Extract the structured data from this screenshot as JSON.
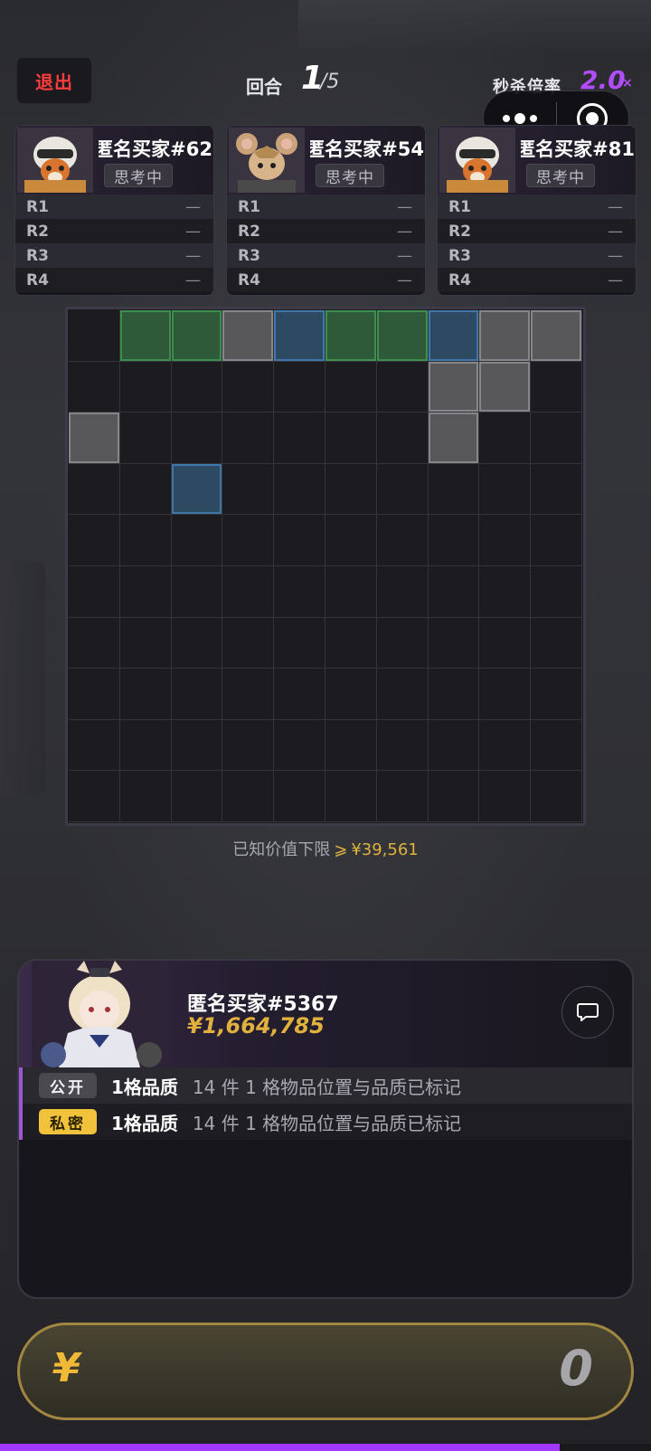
{
  "header": {
    "exit_label": "退出",
    "round_label": "回合",
    "round_current": "1",
    "round_total": "/5",
    "multiplier_label": "秒杀倍率",
    "multiplier_value": "2.0",
    "multiplier_suffix": "×"
  },
  "miniprogram_capsule": {
    "more_icon": "more-dots-icon",
    "close_icon": "target-close-icon"
  },
  "players": [
    {
      "name": "匿名买家#62",
      "status": "思考中",
      "avatar_icon": "fox-pilot-avatar",
      "rounds": [
        {
          "label": "R1",
          "value": "—"
        },
        {
          "label": "R2",
          "value": "—"
        },
        {
          "label": "R3",
          "value": "—"
        },
        {
          "label": "R4",
          "value": "—"
        }
      ]
    },
    {
      "name": "匿名买家#54",
      "status": "思考中",
      "avatar_icon": "mouse-soldier-avatar",
      "rounds": [
        {
          "label": "R1",
          "value": "—"
        },
        {
          "label": "R2",
          "value": "—"
        },
        {
          "label": "R3",
          "value": "—"
        },
        {
          "label": "R4",
          "value": "—"
        }
      ]
    },
    {
      "name": "匿名买家#81",
      "status": "思考中",
      "avatar_icon": "fox-pilot-avatar",
      "rounds": [
        {
          "label": "R1",
          "value": "—"
        },
        {
          "label": "R2",
          "value": "—"
        },
        {
          "label": "R3",
          "value": "—"
        },
        {
          "label": "R4",
          "value": "—"
        }
      ]
    }
  ],
  "grid": {
    "rows": 10,
    "cols": 10,
    "colors": {
      "green": "#3c8f4d",
      "blue": "#3f78a8",
      "gray": "#86858a"
    },
    "marked": [
      [
        "",
        "green",
        "green",
        "gray",
        "blue",
        "green",
        "green",
        "blue",
        "gray",
        "gray"
      ],
      [
        "",
        "",
        "",
        "",
        "",
        "",
        "",
        "gray",
        "gray",
        ""
      ],
      [
        "gray",
        "",
        "",
        "",
        "",
        "",
        "",
        "gray",
        "",
        ""
      ],
      [
        "",
        "",
        "blue",
        "",
        "",
        "",
        "",
        "",
        "",
        ""
      ],
      [
        "",
        "",
        "",
        "",
        "",
        "",
        "",
        "",
        "",
        ""
      ],
      [
        "",
        "",
        "",
        "",
        "",
        "",
        "",
        "",
        "",
        ""
      ],
      [
        "",
        "",
        "",
        "",
        "",
        "",
        "",
        "",
        "",
        ""
      ],
      [
        "",
        "",
        "",
        "",
        "",
        "",
        "",
        "",
        "",
        ""
      ],
      [
        "",
        "",
        "",
        "",
        "",
        "",
        "",
        "",
        "",
        ""
      ],
      [
        "",
        "",
        "",
        "",
        "",
        "",
        "",
        "",
        "",
        ""
      ]
    ]
  },
  "value_info": {
    "label": "已知价值下限",
    "symbol": "⩾",
    "amount": "¥39,561"
  },
  "me": {
    "name": "匿名买家#5367",
    "money": "¥1,664,785",
    "avatar_icon": "bunny-girl-avatar",
    "chat_icon": "chat-bubble-icon",
    "clues": [
      {
        "tag": "公开",
        "title": "1格品质",
        "desc": "14 件 1 格物品位置与品质已标记"
      },
      {
        "tag": "私密",
        "title": "1格品质",
        "desc": "14 件 1 格物品位置与品质已标记"
      }
    ]
  },
  "bid": {
    "currency": "¥",
    "value": "0"
  },
  "timer_progress": 0.86,
  "accent_color": "#a238ff",
  "gold_color": "#e0b23d"
}
